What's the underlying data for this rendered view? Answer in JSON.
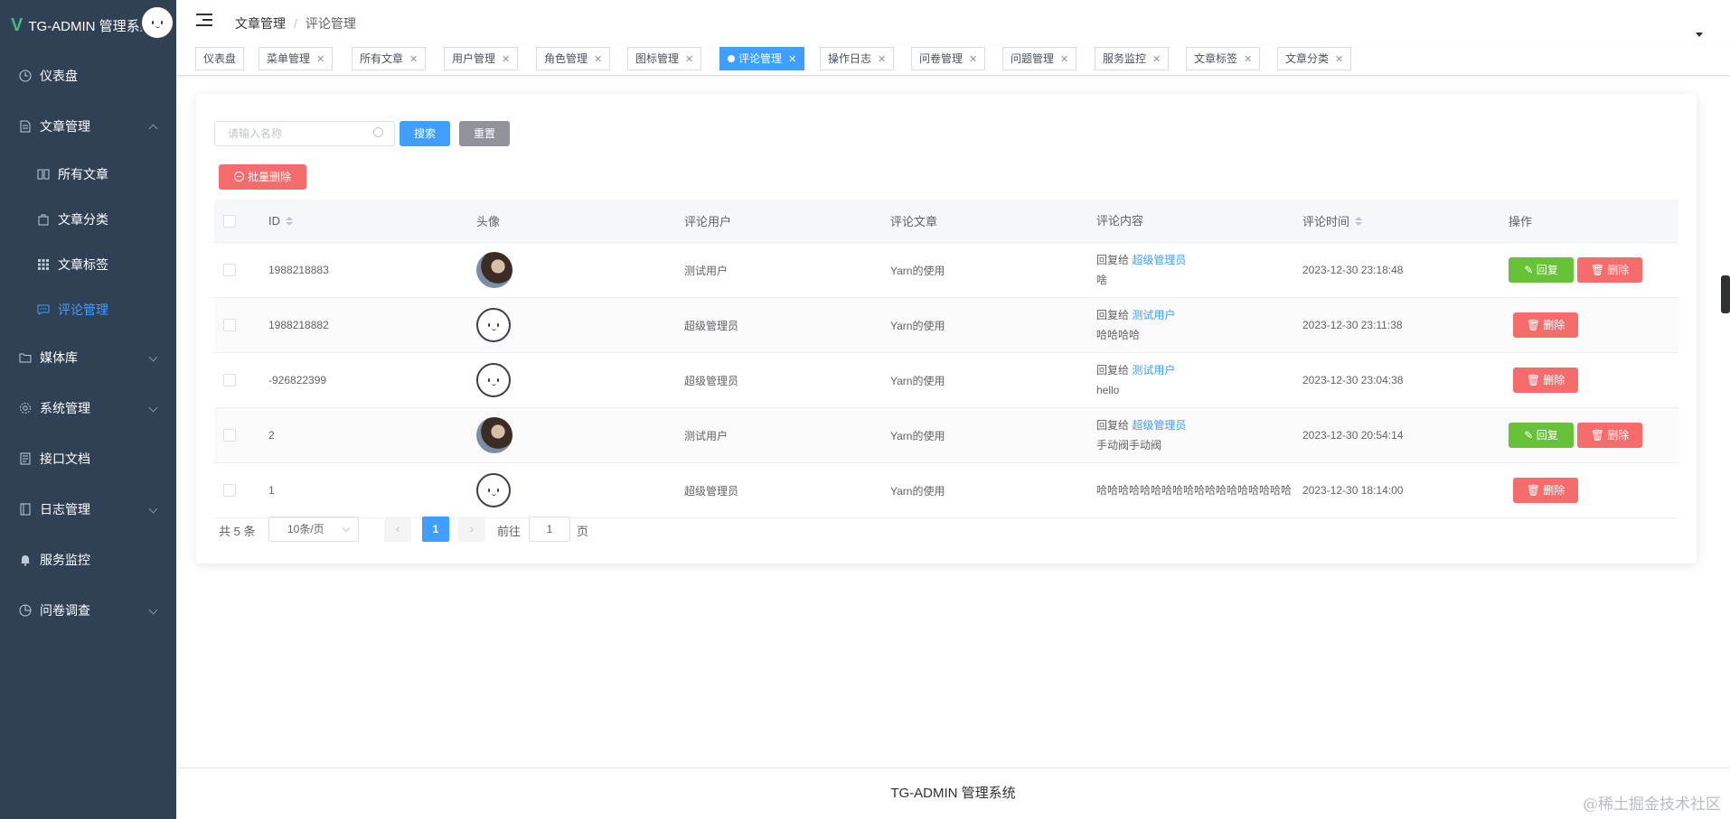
{
  "app": {
    "title": "TG-ADMIN 管理系统",
    "logo_letter": "V"
  },
  "sidebar": {
    "dashboard": "仪表盘",
    "articles": "文章管理",
    "sub": [
      "所有文章",
      "文章分类",
      "文章标签",
      "评论管理"
    ],
    "media": "媒体库",
    "system": "系统管理",
    "api_docs": "接口文档",
    "logs": "日志管理",
    "monitor": "服务监控",
    "survey": "问卷调查"
  },
  "header": {
    "breadcrumb": [
      "文章管理",
      "评论管理"
    ]
  },
  "tags": [
    "仪表盘",
    "菜单管理",
    "所有文章",
    "用户管理",
    "角色管理",
    "图标管理",
    "评论管理",
    "操作日志",
    "问卷管理",
    "问题管理",
    "服务监控",
    "文章标签",
    "文章分类"
  ],
  "search": {
    "placeholder": "请输入名称",
    "search_label": "搜索",
    "reset_label": "重置",
    "batch_delete_label": "批量删除"
  },
  "table": {
    "headers": {
      "id": "ID",
      "avatar": "头像",
      "user": "评论用户",
      "article": "评论文章",
      "content": "评论内容",
      "time": "评论时间",
      "ops": "操作"
    },
    "rows": [
      {
        "id": "1988218883",
        "avatar": "photo",
        "user": "测试用户",
        "article": "Yarn的使用",
        "reply_prefix": "回复给",
        "reply_to": "超级管理员",
        "content": "啥",
        "time": "2023-12-30 23:18:48",
        "can_reply": true
      },
      {
        "id": "1988218882",
        "avatar": "face",
        "user": "超级管理员",
        "article": "Yarn的使用",
        "reply_prefix": "回复给",
        "reply_to": "测试用户",
        "content": "哈哈哈哈",
        "time": "2023-12-30 23:11:38",
        "can_reply": false
      },
      {
        "id": "-926822399",
        "avatar": "face",
        "user": "超级管理员",
        "article": "Yarn的使用",
        "reply_prefix": "回复给",
        "reply_to": "测试用户",
        "content": "hello",
        "time": "2023-12-30 23:04:38",
        "can_reply": false
      },
      {
        "id": "2",
        "avatar": "photo",
        "user": "测试用户",
        "article": "Yarn的使用",
        "reply_prefix": "回复给",
        "reply_to": "超级管理员",
        "content": "手动阀手动阀",
        "time": "2023-12-30 20:54:14",
        "can_reply": true
      },
      {
        "id": "1",
        "avatar": "face",
        "user": "超级管理员",
        "article": "Yarn的使用",
        "reply_prefix": "",
        "reply_to": "",
        "content": "哈哈哈哈哈哈哈哈哈哈哈哈哈哈哈哈哈哈",
        "time": "2023-12-30 18:14:00",
        "can_reply": false
      }
    ],
    "reply_label": "回复",
    "delete_label": "删除"
  },
  "pagination": {
    "total": "共 5 条",
    "page_size": "10条/页",
    "current": "1",
    "goto_label": "前往",
    "goto_value": "1",
    "page_suffix": "页"
  },
  "footer": {
    "text": "TG-ADMIN 管理系统"
  },
  "watermark": "@稀土掘金技术社区",
  "colors": {
    "sidebar_bg": "#304156",
    "primary": "#409eff",
    "success": "#67c23a",
    "danger": "#f56c6c",
    "info": "#909399"
  }
}
